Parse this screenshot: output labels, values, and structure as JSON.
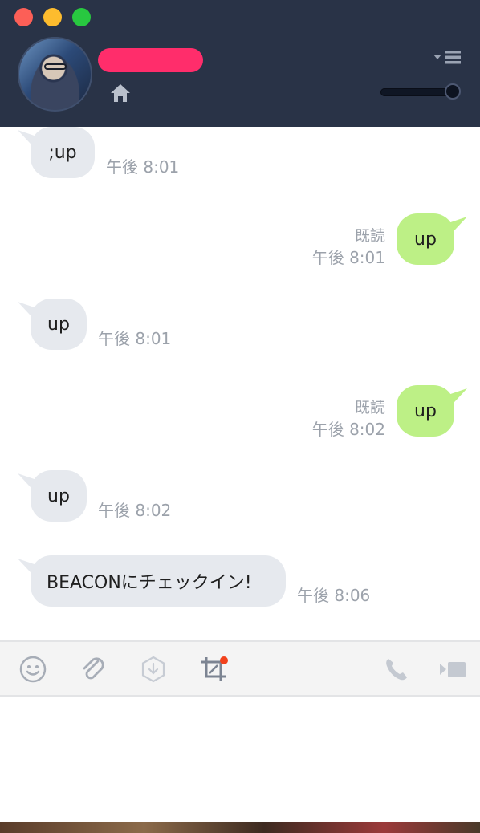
{
  "window": {
    "controls": [
      "close",
      "minimize",
      "maximize"
    ]
  },
  "header": {
    "avatar": "profile-photo",
    "icons": {
      "home": "home-icon",
      "menu": "dropdown-menu-icon"
    },
    "zoom_level_fraction": 0.95
  },
  "messages": [
    {
      "direction": "in",
      "text": ";up",
      "time": "午後 8:01"
    },
    {
      "direction": "out",
      "text": "up",
      "read": "既読",
      "time": "午後 8:01"
    },
    {
      "direction": "in",
      "text": "up",
      "time": "午後 8:01"
    },
    {
      "direction": "out",
      "text": "up",
      "read": "既読",
      "time": "午後 8:02"
    },
    {
      "direction": "in",
      "text": "up",
      "time": "午後 8:02"
    },
    {
      "direction": "in",
      "text": "BEACONにチェックイン!",
      "time": "午後 8:06"
    }
  ],
  "toolbar": {
    "icons": [
      "emoji-icon",
      "attachment-icon",
      "keep-save-icon",
      "crop-screenshot-icon",
      "phone-icon",
      "video-call-icon"
    ],
    "colors": {
      "icon": "#a7adb7",
      "dark_icon": "#7c8492",
      "notify": "#f2421c"
    }
  },
  "colors": {
    "header_bg": "#293347",
    "bubble_in": "#e6e9ee",
    "bubble_out": "#bdf086",
    "meta_text": "#9ca2ab"
  }
}
